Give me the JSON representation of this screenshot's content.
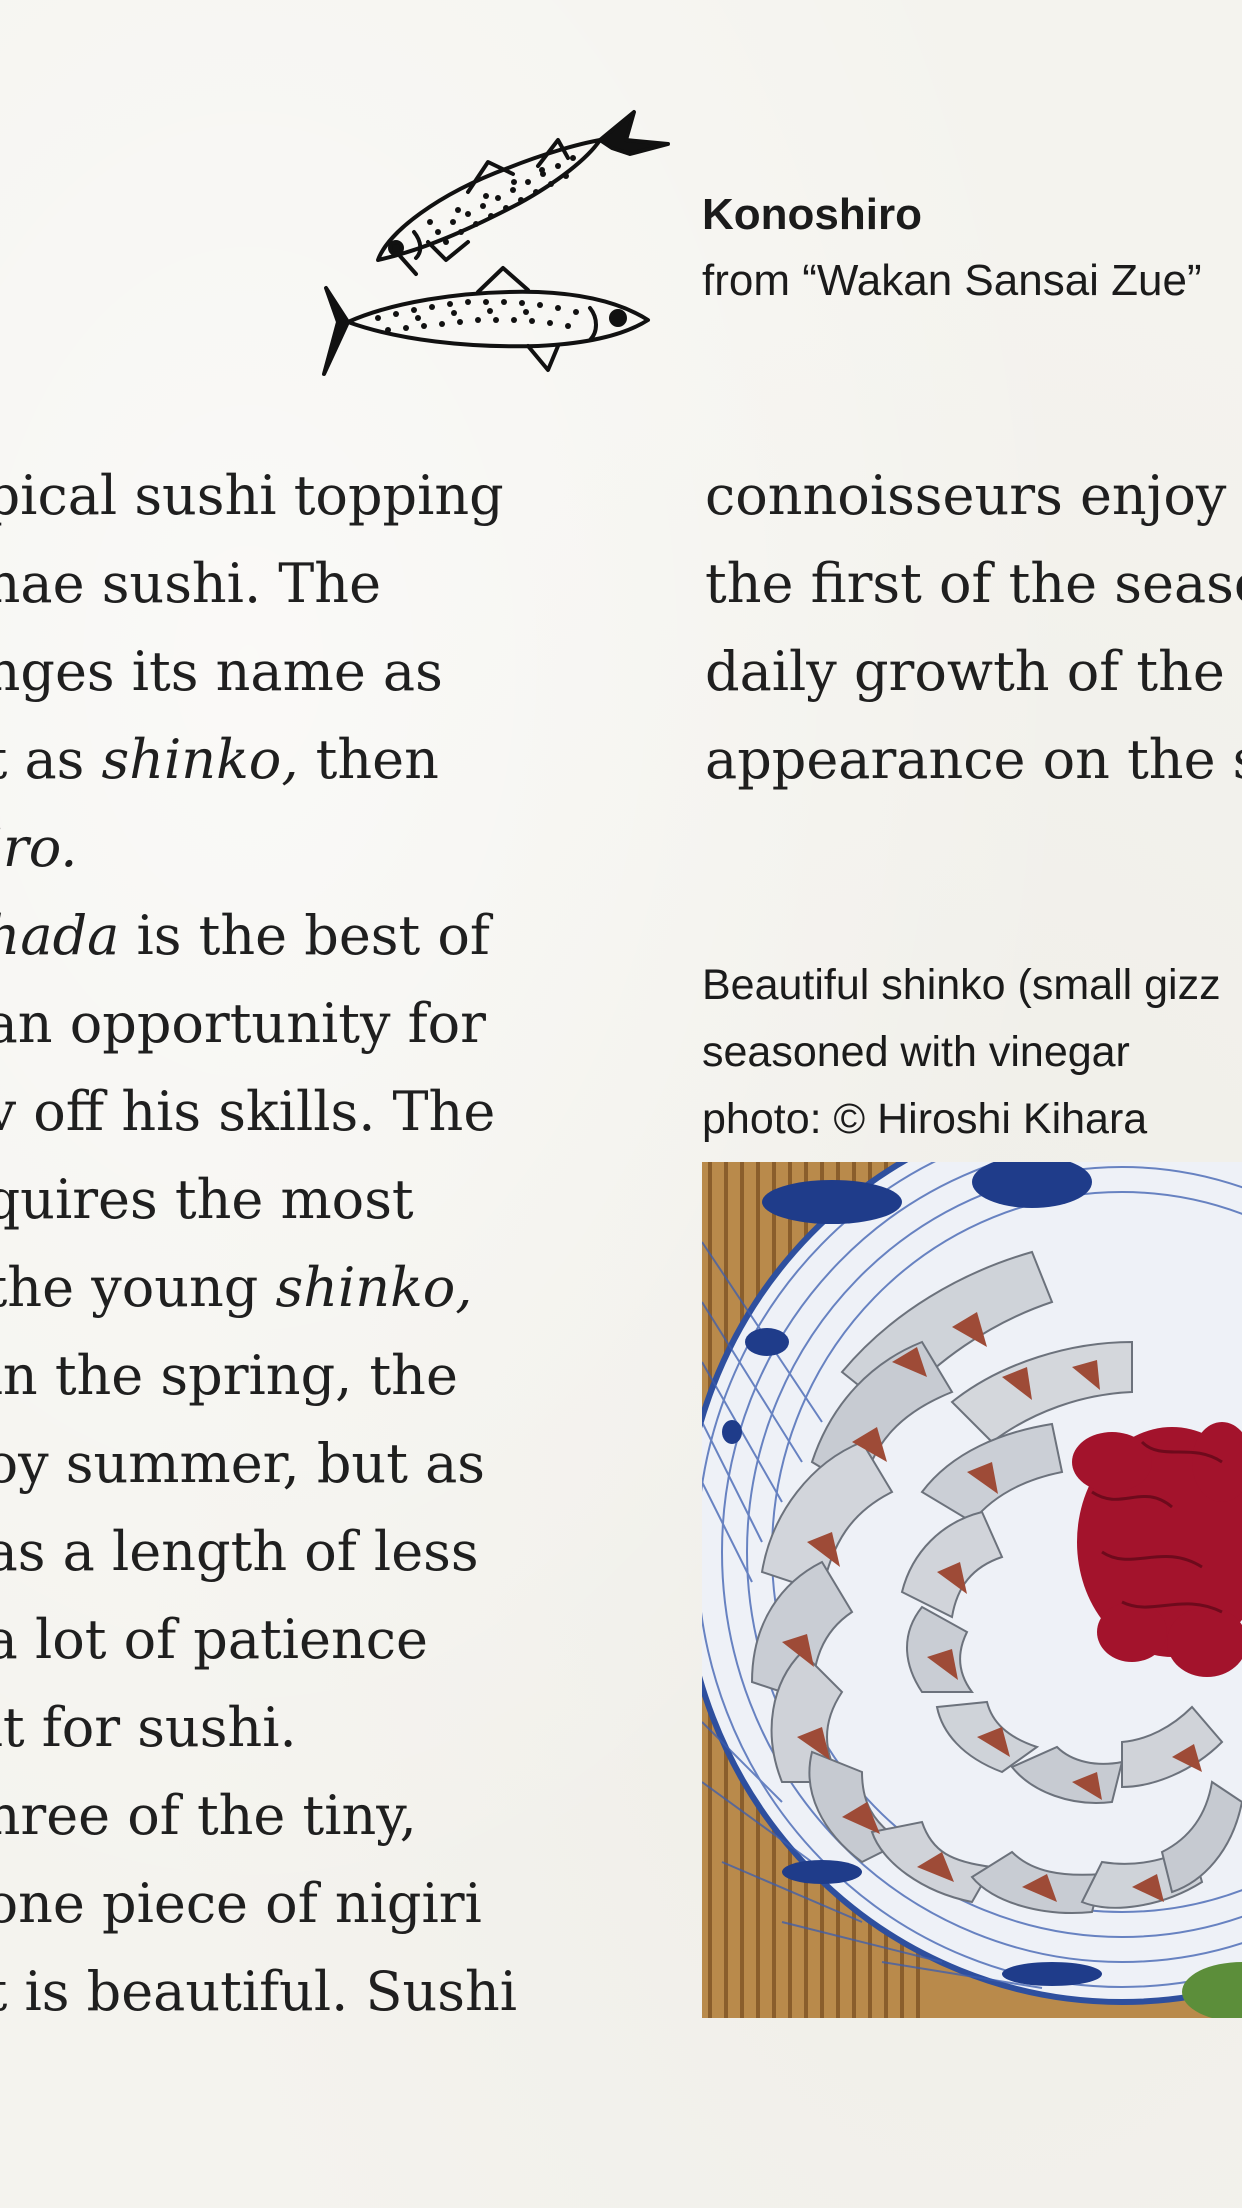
{
  "illustration": {
    "icon": "konoshiro-fish-woodcut-icon"
  },
  "figure_caption": {
    "title": "Konoshiro",
    "source": "from “Wakan Sansai Zue”"
  },
  "left_column": {
    "lines": [
      "pical sushi topping",
      "nae sushi. The",
      "nges its name as",
      "t as ",
      "shinko,",
      " then",
      "iro.",
      "hada",
      " is the best of",
      " an opportunity for",
      "v off his skills. The",
      "quires the most",
      "the young ",
      "shinko,",
      " in the spring, the",
      "oy summer, but as",
      "as a length of less",
      "a lot of patience",
      " it for sushi.",
      "hree of the tiny,",
      "one piece of nigiri",
      "t is beautiful. Sushi"
    ]
  },
  "right_column": {
    "lines": [
      "connoisseurs enjoy",
      "the first of the seaso",
      "daily growth of the",
      "appearance on the s"
    ]
  },
  "photo_caption": {
    "line1": "Beautiful shinko (small gizz",
    "line2": "seasoned with vinegar",
    "line3": "photo: © Hiroshi Kihara"
  },
  "photo": {
    "icon": "shinko-sushi-plate-photo",
    "colors": {
      "plate": "#f2f4f8",
      "plate_pattern": "#2c4d9c",
      "fish_silver": "#c9ccd2",
      "fish_flesh": "#a85a44",
      "seaweed": "#a0162e",
      "bamboo_mat": "#c89a55"
    }
  }
}
